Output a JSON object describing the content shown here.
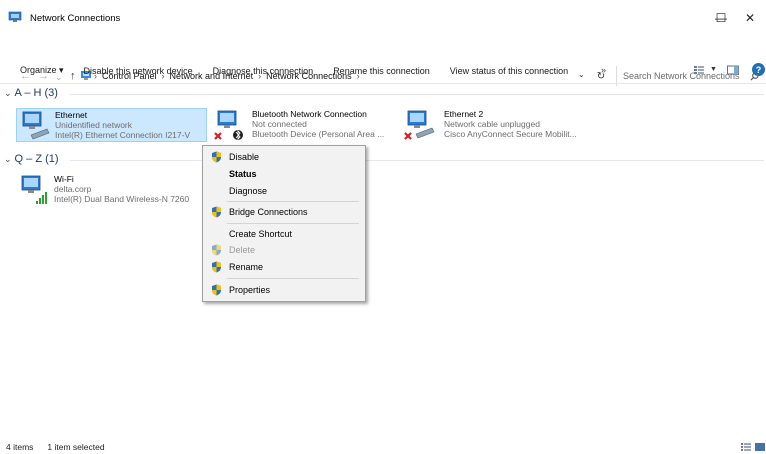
{
  "window": {
    "title": "Network Connections",
    "minimize_label": "—",
    "maximize_label": "☐",
    "close_label": "✕"
  },
  "address": {
    "back": "←",
    "forward": "→",
    "recent": "⌄",
    "up": "↑",
    "breadcrumbs": [
      "Control Panel",
      "Network and Internet",
      "Network Connections"
    ],
    "separator": "›",
    "refresh": "↻",
    "search_placeholder": "Search Network Connections"
  },
  "commands": {
    "organize": "Organize ▾",
    "disable": "Disable this network device",
    "diagnose": "Diagnose this connection",
    "rename": "Rename this connection",
    "view_status": "View status of this connection",
    "more": "»",
    "help": "?"
  },
  "groups": [
    {
      "label": "A – H (3)"
    },
    {
      "label": "Q – Z (1)"
    }
  ],
  "items": [
    {
      "name": "Ethernet",
      "status": "Unidentified network",
      "device": "Intel(R) Ethernet Connection I217-V"
    },
    {
      "name": "Bluetooth Network Connection",
      "status": "Not connected",
      "device": "Bluetooth Device (Personal Area ..."
    },
    {
      "name": "Ethernet 2",
      "status": "Network cable unplugged",
      "device": "Cisco AnyConnect Secure Mobilit..."
    },
    {
      "name": "Wi-Fi",
      "status": "delta.corp",
      "device": "Intel(R) Dual Band Wireless-N 7260"
    }
  ],
  "context_menu": {
    "disable": "Disable",
    "status": "Status",
    "diagnose": "Diagnose",
    "bridge": "Bridge Connections",
    "shortcut": "Create Shortcut",
    "delete": "Delete",
    "rename": "Rename",
    "properties": "Properties"
  },
  "statusbar": {
    "count": "4 items",
    "selected": "1 item selected"
  },
  "colors": {
    "selection_bg": "#cce8ff",
    "group_header": "#1e3a66",
    "accent": "#1f6fb5"
  }
}
